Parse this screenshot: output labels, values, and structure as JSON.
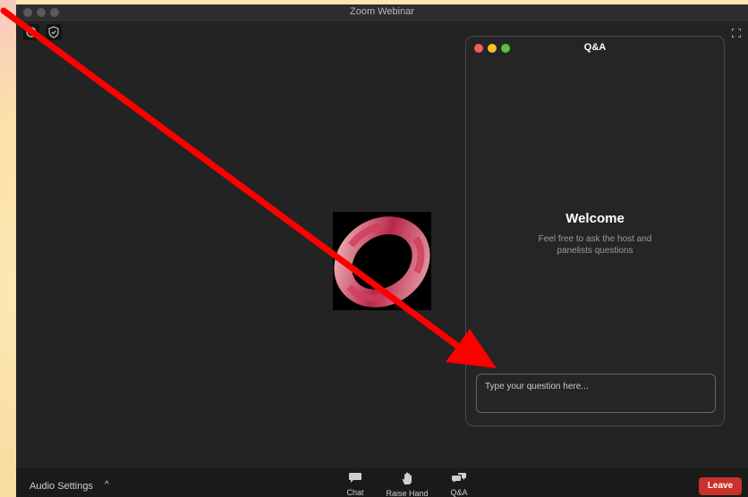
{
  "window": {
    "title": "Zoom Webinar"
  },
  "qa_panel": {
    "title": "Q&A",
    "welcome": "Welcome",
    "subtitle": "Feel free to ask the host and panelists questions",
    "input_placeholder": "Type your question here..."
  },
  "toolbar": {
    "audio_settings": "Audio Settings",
    "audio_caret": "^",
    "chat": "Chat",
    "raise_hand": "Raise Hand",
    "qa": "Q&A",
    "leave": "Leave"
  },
  "icons": {
    "top_left_1": "info-icon",
    "top_left_2": "shield-check-icon",
    "expand": "fullscreen-icon",
    "chat": "chat-bubble-icon",
    "raise_hand": "hand-icon",
    "qa": "qa-bubbles-icon"
  },
  "colors": {
    "leave_button": "#c9312b",
    "dot_red": "#ee5f57",
    "dot_yellow": "#f5bf2f",
    "dot_green": "#58c23d",
    "annotation_arrow": "#ff0000"
  }
}
